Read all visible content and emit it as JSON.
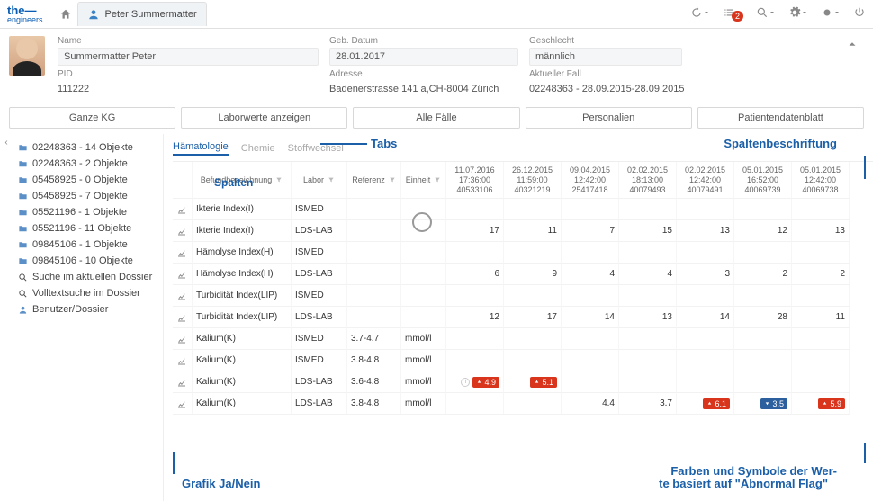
{
  "brand": {
    "line1": "the",
    "line2": "engineers"
  },
  "header": {
    "patient_name": "Peter Summermatter",
    "badge_count": "2"
  },
  "info": {
    "labels": {
      "name": "Name",
      "geb": "Geb. Datum",
      "gesch": "Geschlecht",
      "pid": "PID",
      "adr": "Adresse",
      "fall": "Aktueller Fall"
    },
    "name": "Summermatter Peter",
    "geb": "28.01.2017",
    "gesch": "männlich",
    "pid": "111222",
    "adr": "Badenerstrasse 141 a,CH-8004 Zürich",
    "fall": "02248363 - 28.09.2015-28.09.2015"
  },
  "buttons": [
    "Ganze KG",
    "Laborwerte anzeigen",
    "Alle Fälle",
    "Personalien",
    "Patientendatenblatt"
  ],
  "sidebar": [
    {
      "icon": "folder",
      "label": "02248363 - 14 Objekte"
    },
    {
      "icon": "folder",
      "label": "02248363 - 2 Objekte"
    },
    {
      "icon": "folder",
      "label": "05458925 - 0 Objekte"
    },
    {
      "icon": "folder",
      "label": "05458925 - 7 Objekte"
    },
    {
      "icon": "folder",
      "label": "05521196 - 1 Objekte"
    },
    {
      "icon": "folder",
      "label": "05521196 - 11 Objekte"
    },
    {
      "icon": "folder",
      "label": "09845106 - 1 Objekte"
    },
    {
      "icon": "folder",
      "label": "09845106 - 10 Objekte"
    },
    {
      "icon": "search",
      "label": "Suche im aktuellen Dossier"
    },
    {
      "icon": "search",
      "label": "Volltextsuche im Dossier"
    },
    {
      "icon": "user",
      "label": "Benutzer/Dossier"
    }
  ],
  "tabs": [
    "Hämatologie",
    "Chemie",
    "Stoffwechsel"
  ],
  "annotations": {
    "tabs": "Tabs",
    "spaltenb": "Spaltenbeschriftung",
    "spalten": "Spalten",
    "grafik": "Grafik Ja/Nein",
    "farben1": "Farben und Symbole der Wer-",
    "farben2": "te basiert auf \"Abnormal Flag\""
  },
  "columns": {
    "befund": "Befundbezeichnung",
    "labor": "Labor",
    "referenz": "Referenz",
    "einheit": "Einheit"
  },
  "dates": [
    {
      "d": "11.07.2016",
      "t": "17:36:00",
      "id": "40533106"
    },
    {
      "d": "26.12.2015",
      "t": "11:59:00",
      "id": "40321219"
    },
    {
      "d": "09.04.2015",
      "t": "12:42:00",
      "id": "25417418"
    },
    {
      "d": "02.02.2015",
      "t": "18:13:00",
      "id": "40079493"
    },
    {
      "d": "02.02.2015",
      "t": "12:42:00",
      "id": "40079491"
    },
    {
      "d": "05.01.2015",
      "t": "16:52:00",
      "id": "40069739"
    },
    {
      "d": "05.01.2015",
      "t": "12:42:00",
      "id": "40069738"
    }
  ],
  "rows": [
    {
      "name": "Ikterie Index(I)",
      "lab": "ISMED",
      "ref": "",
      "unit": "",
      "v": [
        "",
        "",
        "",
        "",
        "",
        "",
        ""
      ]
    },
    {
      "name": "Ikterie Index(I)",
      "lab": "LDS-LAB",
      "ref": "",
      "unit": "",
      "v": [
        "17",
        "11",
        "7",
        "15",
        "13",
        "12",
        "13"
      ]
    },
    {
      "name": "Hämolyse Index(H)",
      "lab": "ISMED",
      "ref": "",
      "unit": "",
      "v": [
        "",
        "",
        "",
        "",
        "",
        "",
        ""
      ]
    },
    {
      "name": "Hämolyse Index(H)",
      "lab": "LDS-LAB",
      "ref": "",
      "unit": "",
      "v": [
        "6",
        "9",
        "4",
        "4",
        "3",
        "2",
        "2"
      ]
    },
    {
      "name": "Turbidität Index(LIP)",
      "lab": "ISMED",
      "ref": "",
      "unit": "",
      "v": [
        "",
        "",
        "",
        "",
        "",
        "",
        ""
      ]
    },
    {
      "name": "Turbidität Index(LIP)",
      "lab": "LDS-LAB",
      "ref": "",
      "unit": "",
      "v": [
        "12",
        "17",
        "14",
        "13",
        "14",
        "28",
        "11"
      ]
    },
    {
      "name": "Kalium(K)",
      "lab": "ISMED",
      "ref": "3.7-4.7",
      "unit": "mmol/l",
      "v": [
        "",
        "",
        "",
        "",
        "",
        "",
        ""
      ]
    },
    {
      "name": "Kalium(K)",
      "lab": "ISMED",
      "ref": "3.8-4.8",
      "unit": "mmol/l",
      "v": [
        "",
        "",
        "",
        "",
        "",
        "",
        ""
      ]
    },
    {
      "name": "Kalium(K)",
      "lab": "LDS-LAB",
      "ref": "3.6-4.8",
      "unit": "mmol/l",
      "v": [
        {
          "t": "info_hi",
          "val": "4.9"
        },
        {
          "t": "hi",
          "val": "5.1"
        },
        "",
        "",
        "",
        "",
        ""
      ]
    },
    {
      "name": "Kalium(K)",
      "lab": "LDS-LAB",
      "ref": "3.8-4.8",
      "unit": "mmol/l",
      "v": [
        "",
        "",
        "4.4",
        "3.7",
        {
          "t": "hi",
          "val": "6.1"
        },
        {
          "t": "lo",
          "val": "3.5"
        },
        {
          "t": "hi",
          "val": "5.9"
        }
      ]
    }
  ]
}
